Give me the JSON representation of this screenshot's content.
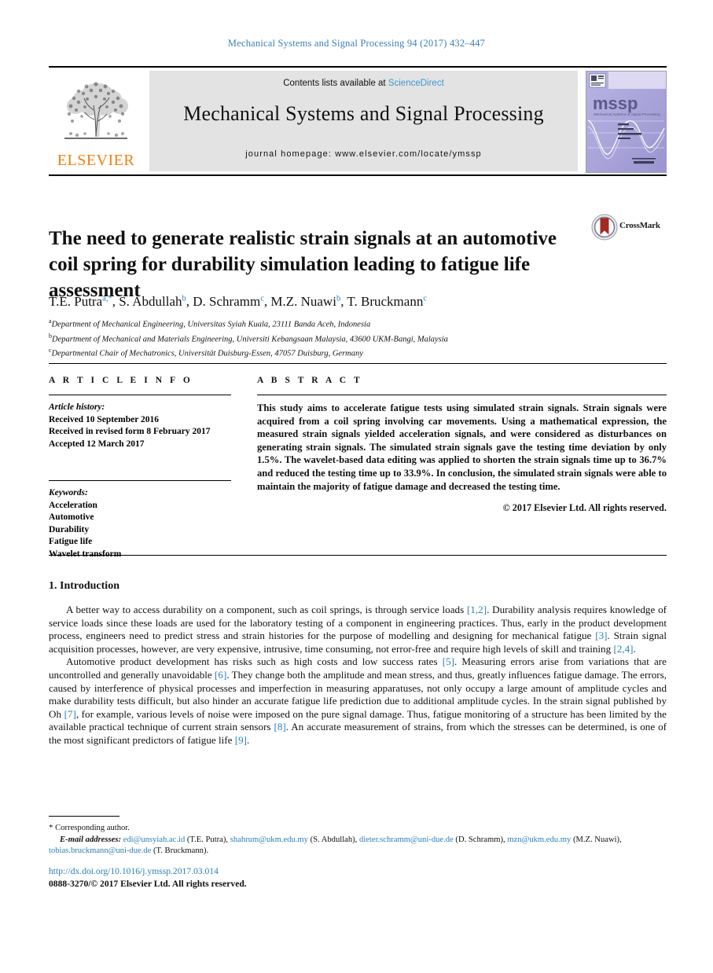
{
  "running_head": "Mechanical Systems and Signal Processing 94 (2017) 432–447",
  "masthead": {
    "contents_prefix": "Contents lists available at ",
    "sciencedirect": "ScienceDirect",
    "journal_title": "Mechanical Systems and Signal Processing",
    "homepage": "journal homepage: www.elsevier.com/locate/ymssp",
    "publisher": "ELSEVIER",
    "cover_wordmark": "mssp",
    "cover_subtitle": "Mechanical Systems & Signal Processing",
    "link_color": "#3f97d3",
    "elsevier_orange": "#f08010"
  },
  "article": {
    "title": "The need to generate realistic strain signals at an automotive coil spring for durability simulation leading to fatigue life assessment",
    "crossmark_label": "CrossMark",
    "authors": [
      {
        "name": "T.E. Putra",
        "marks": "a,*"
      },
      {
        "name": "S. Abdullah",
        "marks": "b"
      },
      {
        "name": "D. Schramm",
        "marks": "c"
      },
      {
        "name": "M.Z. Nuawi",
        "marks": "b"
      },
      {
        "name": "T. Bruckmann",
        "marks": "c"
      }
    ],
    "affiliations": [
      {
        "mark": "a",
        "text": "Department of Mechanical Engineering, Universitas Syiah Kuala, 23111 Banda Aceh, Indonesia"
      },
      {
        "mark": "b",
        "text": "Department of Mechanical and Materials Engineering, Universiti Kebangsaan Malaysia, 43600 UKM-Bangi, Malaysia"
      },
      {
        "mark": "c",
        "text": "Departmental Chair of Mechatronics, Universität Duisburg-Essen, 47057 Duisburg, Germany"
      }
    ]
  },
  "article_info": {
    "heading": "A R T I C L E   I N F O",
    "history_label": "Article history:",
    "history": [
      "Received 10 September 2016",
      "Received in revised form 8 February 2017",
      "Accepted 12 March 2017"
    ],
    "keywords_label": "Keywords:",
    "keywords": [
      "Acceleration",
      "Automotive",
      "Durability",
      "Fatigue life",
      "Wavelet transform"
    ]
  },
  "abstract": {
    "heading": "A B S T R A C T",
    "text": "This study aims to accelerate fatigue tests using simulated strain signals. Strain signals were acquired from a coil spring involving car movements. Using a mathematical expression, the measured strain signals yielded acceleration signals, and were considered as disturbances on generating strain signals. The simulated strain signals gave the testing time deviation by only 1.5%. The wavelet-based data editing was applied to shorten the strain signals time up to 36.7% and reduced the testing time up to 33.9%. In conclusion, the simulated strain signals were able to maintain the majority of fatigue damage and decreased the testing time.",
    "copyright": "© 2017 Elsevier Ltd. All rights reserved."
  },
  "introduction": {
    "heading": "1. Introduction",
    "paragraphs": [
      "A better way to access durability on a component, such as coil springs, is through service loads [1,2]. Durability analysis requires knowledge of service loads since these loads are used for the laboratory testing of a component in engineering practices. Thus, early in the product development process, engineers need to predict stress and strain histories for the purpose of modelling and designing for mechanical fatigue [3]. Strain signal acquisition processes, however, are very expensive, intrusive, time consuming, not error-free and require high levels of skill and training [2,4].",
      "Automotive product development has risks such as high costs and low success rates [5]. Measuring errors arise from variations that are uncontrolled and generally unavoidable [6]. They change both the amplitude and mean stress, and thus, greatly influences fatigue damage. The errors, caused by interference of physical processes and imperfection in measuring apparatuses, not only occupy a large amount of amplitude cycles and make durability tests difficult, but also hinder an accurate fatigue life prediction due to additional amplitude cycles. In the strain signal published by Oh [7], for example, various levels of noise were imposed on the pure signal damage. Thus, fatigue monitoring of a structure has been limited by the available practical technique of current strain sensors [8]. An accurate measurement of strains, from which the stresses can be determined, is one of the most significant predictors of fatigue life [9]."
    ]
  },
  "footer": {
    "corresponding_marker": "*",
    "corresponding_text": "Corresponding author.",
    "email_label": "E-mail addresses:",
    "emails": [
      {
        "address": "edi@unsyiah.ac.id",
        "owner": "(T.E. Putra)"
      },
      {
        "address": "shahrum@ukm.edu.my",
        "owner": "(S. Abdullah)"
      },
      {
        "address": "dieter.schramm@uni-due.de",
        "owner": "(D. Schramm)"
      },
      {
        "address": "mzn@ukm.edu.my",
        "owner": "(M.Z. Nuawi)"
      },
      {
        "address": "tobias.bruckmann@uni-due.de",
        "owner": "(T. Bruckmann)"
      }
    ],
    "doi": "http://dx.doi.org/10.1016/j.ymssp.2017.03.014",
    "issn_line": "0888-3270/© 2017 Elsevier Ltd. All rights reserved."
  }
}
